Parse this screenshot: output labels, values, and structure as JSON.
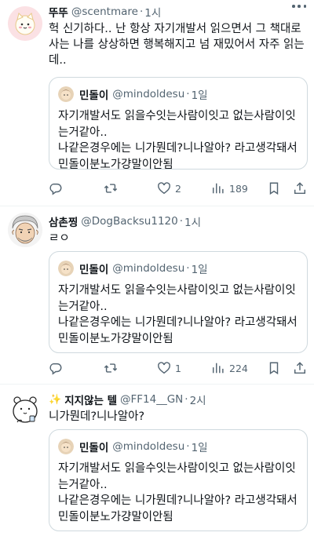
{
  "posts": [
    {
      "name": "뚜뚜",
      "handle": "@scentmare",
      "dot": "·",
      "time": "1시",
      "text": "헉 신기하다.. 난 항상 자기개발서 읽으면서 그 책대로 사는 나를 상상하면 행복해지고 넘 재밌어서 자주 읽는데..",
      "replies": "",
      "retweets": "",
      "likes": "2",
      "views": "189"
    },
    {
      "name": "삼촌찡",
      "handle": "@DogBacksu1120",
      "dot": "·",
      "time": "1시",
      "text": "ㄹㅇ",
      "replies": "",
      "retweets": "",
      "likes": "1",
      "views": "224"
    },
    {
      "name_emoji": "✨",
      "name": "지지않는 텔",
      "handle": "@FF14__GN",
      "dot": "·",
      "time": "2시",
      "text": "니가뭔데?니나알아?"
    }
  ],
  "quote": {
    "name": "민돌이",
    "handle": "@mindoldesu",
    "dot": "·",
    "time": "1일",
    "line1": "자기개발서도 읽을수잇는사람이잇고 없는사람이잇는거같아..",
    "line2": "나같은경우에는 니가뭔데?니나알아? 라고생각돼서 민돌이분노가걍말이안됨"
  },
  "icons": {
    "reply": "reply-icon",
    "retweet": "retweet-icon",
    "like": "heart-icon",
    "views": "views-icon",
    "bookmark": "bookmark-icon",
    "share": "share-icon",
    "more": "more-icon"
  },
  "colors": {
    "text": "#0f1419",
    "muted": "#536471",
    "border": "#cfd9de"
  }
}
